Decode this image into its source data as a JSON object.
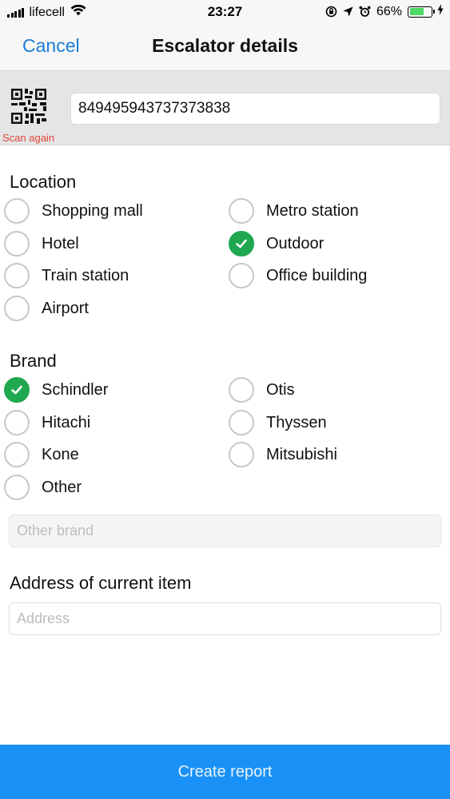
{
  "status_bar": {
    "carrier": "lifecell",
    "time": "23:27",
    "battery_percent": "66%",
    "battery_level": 0.66,
    "icons": [
      "signal-icon",
      "wifi-icon",
      "orientation-lock-icon",
      "location-arrow-icon",
      "alarm-icon",
      "battery-icon",
      "charging-icon"
    ]
  },
  "nav": {
    "cancel_label": "Cancel",
    "title": "Escalator details"
  },
  "scan": {
    "code_value": "849495943737373838",
    "scan_again_label": "Scan again",
    "icon": "qr-code-icon"
  },
  "location": {
    "title": "Location",
    "options": [
      {
        "label": "Shopping mall",
        "checked": false
      },
      {
        "label": "Metro station",
        "checked": false
      },
      {
        "label": "Hotel",
        "checked": false
      },
      {
        "label": "Outdoor",
        "checked": true
      },
      {
        "label": "Train station",
        "checked": false
      },
      {
        "label": "Office building",
        "checked": false
      },
      {
        "label": "Airport",
        "checked": false
      }
    ]
  },
  "brand": {
    "title": "Brand",
    "options": [
      {
        "label": "Schindler",
        "checked": true
      },
      {
        "label": "Otis",
        "checked": false
      },
      {
        "label": "Hitachi",
        "checked": false
      },
      {
        "label": "Thyssen",
        "checked": false
      },
      {
        "label": "Kone",
        "checked": false
      },
      {
        "label": "Mitsubishi",
        "checked": false
      },
      {
        "label": "Other",
        "checked": false
      }
    ],
    "other_placeholder": "Other brand"
  },
  "address": {
    "title": "Address of current item",
    "placeholder": "Address"
  },
  "footer": {
    "create_label": "Create report"
  },
  "colors": {
    "accent": "#1a7bd6",
    "check_green": "#1fa84f",
    "scan_again_red": "#e0453a",
    "button_blue": "#1991f7"
  }
}
